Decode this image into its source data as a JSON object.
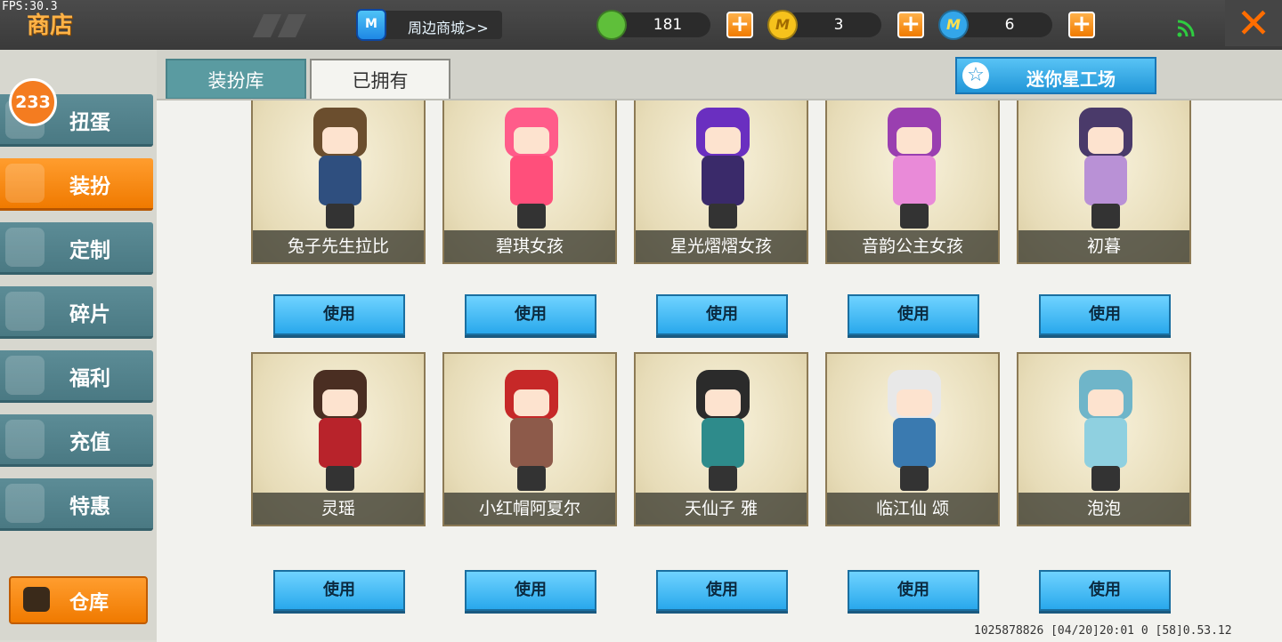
{
  "fps": "FPS:30.3",
  "header": {
    "title": "商店",
    "peripheral_label": "周边商城>>",
    "bag_letter": "M",
    "currencies": [
      {
        "name": "green-gem",
        "amount": "181",
        "color": "#5fbf3a",
        "symbol": ""
      },
      {
        "name": "gold-coin",
        "amount": "3",
        "color": "#f6c21c",
        "symbol": "M"
      },
      {
        "name": "blue-coin",
        "amount": "6",
        "color": "#33a6ea",
        "symbol": "M"
      }
    ],
    "plus_symbol": "+",
    "close_symbol": "✕"
  },
  "sidebar": {
    "badge": "233",
    "items": [
      {
        "label": "扭蛋",
        "active": false
      },
      {
        "label": "装扮",
        "active": true
      },
      {
        "label": "定制",
        "active": false
      },
      {
        "label": "碎片",
        "active": false
      },
      {
        "label": "福利",
        "active": false
      },
      {
        "label": "充值",
        "active": false
      },
      {
        "label": "特惠",
        "active": false
      }
    ],
    "warehouse_label": "仓库"
  },
  "tabs": {
    "library": "装扮库",
    "owned": "已拥有"
  },
  "mini_star": {
    "label": "迷你星工场",
    "icon": "☆"
  },
  "use_label": "使用",
  "costumes": [
    {
      "name": "兔子先生拉比",
      "hair": "#6b4e2e",
      "outfit": "#2f4f7f"
    },
    {
      "name": "碧琪女孩",
      "hair": "#ff5c8a",
      "outfit": "#ff4f7b"
    },
    {
      "name": "星光熠熠女孩",
      "hair": "#6a2fc0",
      "outfit": "#3a2a6a"
    },
    {
      "name": "音韵公主女孩",
      "hair": "#9a3fb0",
      "outfit": "#e98ad8"
    },
    {
      "name": "初暮",
      "hair": "#4a3a6a",
      "outfit": "#b991d6"
    },
    {
      "name": "灵瑶",
      "hair": "#4a2e22",
      "outfit": "#b8232b"
    },
    {
      "name": "小红帽阿夏尔",
      "hair": "#c62828",
      "outfit": "#8d5a4a"
    },
    {
      "name": "天仙子 雅",
      "hair": "#2b2b2b",
      "outfit": "#2e8b8b"
    },
    {
      "name": "临江仙 颂",
      "hair": "#e8e8e8",
      "outfit": "#3a7ab0"
    },
    {
      "name": "泡泡",
      "hair": "#6fb5c9",
      "outfit": "#8fd0e0"
    }
  ],
  "status_line": "1025878826  [04/20]20:01 0  [58]0.53.12"
}
